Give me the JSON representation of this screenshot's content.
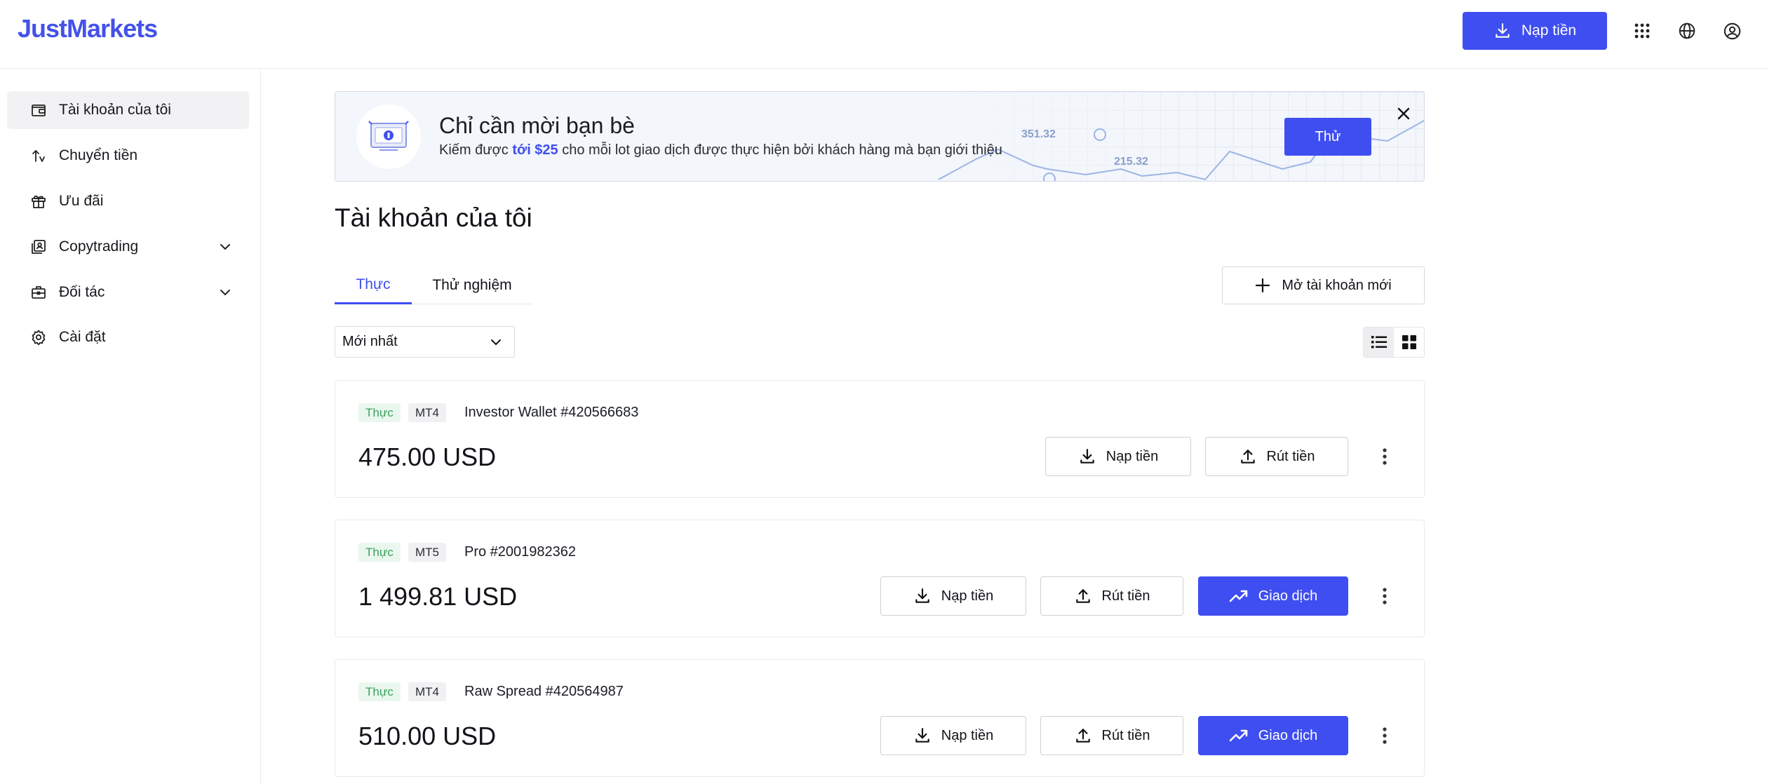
{
  "header": {
    "logo": "JustMarkets",
    "deposit_label": "Nạp tiền",
    "icons": [
      "apps-grid-icon",
      "globe-icon",
      "user-circle-icon"
    ]
  },
  "sidebar": {
    "items": [
      {
        "label": "Tài khoản của tôi",
        "icon": "wallet-icon",
        "active": true
      },
      {
        "label": "Chuyển tiền",
        "icon": "transfer-icon"
      },
      {
        "label": "Ưu đãi",
        "icon": "gift-icon"
      },
      {
        "label": "Copytrading",
        "icon": "copytrading-icon",
        "expandable": true
      },
      {
        "label": "Đối tác",
        "icon": "briefcase-icon",
        "expandable": true
      },
      {
        "label": "Cài đặt",
        "icon": "gear-icon"
      }
    ]
  },
  "banner": {
    "title": "Chỉ cần mời bạn bè",
    "sub_prefix": "Kiếm được ",
    "sub_highlight": "tới $25",
    "sub_suffix": " cho mỗi lot giao dịch được thực hiện bởi khách hàng mà bạn giới thiệu",
    "try_label": "Thử",
    "chart_label_1": "351.32",
    "chart_label_2": "215.32"
  },
  "page_title": "Tài khoản của tôi",
  "tabs": [
    {
      "label": "Thực",
      "active": true
    },
    {
      "label": "Thử nghiệm",
      "active": false
    }
  ],
  "new_account_label": "Mở tài khoản mới",
  "sort": {
    "selected": "Mới nhất"
  },
  "view_modes": [
    "list-view-icon",
    "grid-view-icon"
  ],
  "accounts": [
    {
      "type": "Thực",
      "platform": "MT4",
      "name": "Investor Wallet #420566683",
      "balance": "475.00 USD",
      "deposit": "Nạp tiền",
      "withdraw": "Rút tiền",
      "trade": null
    },
    {
      "type": "Thực",
      "platform": "MT5",
      "name": "Pro #2001982362",
      "balance": "1 499.81 USD",
      "deposit": "Nạp tiền",
      "withdraw": "Rút tiền",
      "trade": "Giao dịch"
    },
    {
      "type": "Thực",
      "platform": "MT4",
      "name": "Raw Spread #420564987",
      "balance": "510.00 USD",
      "deposit": "Nạp tiền",
      "withdraw": "Rút tiền",
      "trade": "Giao dịch"
    }
  ],
  "colors": {
    "accent": "#3f4ef0",
    "badge_green": "#3aa15c"
  }
}
